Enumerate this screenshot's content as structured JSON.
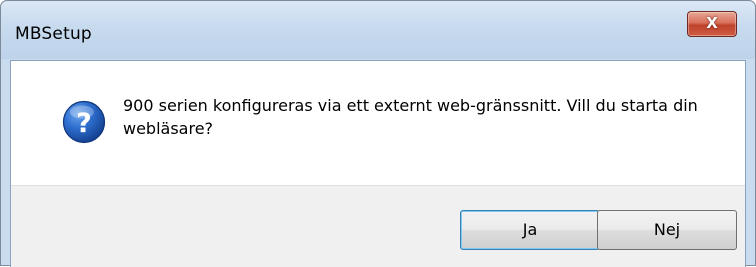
{
  "window": {
    "title": "MBSetup"
  },
  "title_bar": {
    "close_label": "X"
  },
  "dialog": {
    "icon": "question-icon",
    "message": "900 serien konfigureras via ett externt web-gränssnitt. Vill du starta din webläsare?"
  },
  "buttons": {
    "yes_label": "Ja",
    "no_label": "Nej"
  },
  "colors": {
    "title_bar": "#c7daee",
    "close_button": "#c7503a",
    "icon_blue": "#1d56b2",
    "footer": "#f0f0f0"
  }
}
